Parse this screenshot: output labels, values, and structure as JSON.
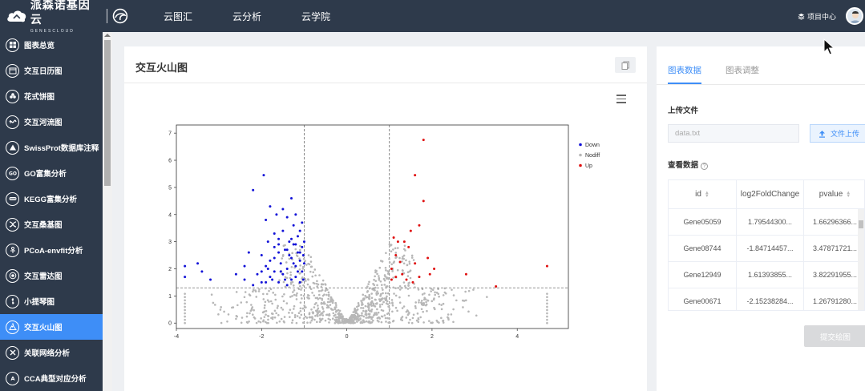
{
  "header": {
    "brand": "派森诺基因云",
    "brand_sub": "GENESCLOUD",
    "nav": [
      "云图汇",
      "云分析",
      "云学院"
    ],
    "project_center": "项目中心"
  },
  "sidebar": {
    "items": [
      {
        "label": "图表总览",
        "icon": "grid-icon"
      },
      {
        "label": "交互日历图",
        "icon": "calendar-icon"
      },
      {
        "label": "花式饼图",
        "icon": "flower-icon"
      },
      {
        "label": "交互河流图",
        "icon": "river-icon"
      },
      {
        "label": "SwissProt数据库注释",
        "icon": "triangle-icon"
      },
      {
        "label": "GO富集分析",
        "icon": "go-icon"
      },
      {
        "label": "KEGG富集分析",
        "icon": "kegg-icon"
      },
      {
        "label": "交互桑基图",
        "icon": "sankey-icon"
      },
      {
        "label": "PCoA-envfit分析",
        "icon": "pcoa-icon"
      },
      {
        "label": "交互雷达图",
        "icon": "radar-icon"
      },
      {
        "label": "小提琴图",
        "icon": "violin-icon"
      },
      {
        "label": "交互火山图",
        "icon": "volcano-icon",
        "active": true
      },
      {
        "label": "关联网络分析",
        "icon": "network-icon"
      },
      {
        "label": "CCA典型对应分析",
        "icon": "cca-icon"
      }
    ]
  },
  "main": {
    "title": "交互火山图"
  },
  "right": {
    "tabs": [
      "图表数据",
      "图表调整"
    ],
    "upload_label": "上传文件",
    "file_value": "data.txt",
    "upload_button": "文件上传",
    "view_data_label": "查看数据",
    "table": {
      "headers": [
        "id",
        "log2FoldChange",
        "pvalue"
      ],
      "rows": [
        [
          "Gene05059",
          "1.79544300...",
          "1.66296366..."
        ],
        [
          "Gene08744",
          "-1.84714457...",
          "3.47871721..."
        ],
        [
          "Gene12949",
          "1.61393855...",
          "3.82291955..."
        ],
        [
          "Gene00671",
          "-2.15238284...",
          "1.26791280..."
        ]
      ]
    },
    "submit_button": "提交绘图"
  },
  "chart_data": {
    "type": "scatter",
    "title": "",
    "xlabel": "",
    "ylabel": "",
    "xlim": [
      -4,
      5.2
    ],
    "ylim": [
      -0.2,
      7.3
    ],
    "xticks": [
      -4,
      -2,
      0,
      2,
      4
    ],
    "yticks": [
      0,
      1,
      2,
      3,
      4,
      5,
      6,
      7
    ],
    "vlines": [
      -1,
      1
    ],
    "hline": 1.3,
    "legend": {
      "position": "top-right"
    },
    "series": [
      {
        "name": "Down",
        "color": "#1313d8",
        "points": [
          [
            -3.8,
            2.1
          ],
          [
            -3.8,
            1.7
          ],
          [
            -3.5,
            2.2
          ],
          [
            -3.4,
            1.9
          ],
          [
            -3.2,
            1.6
          ],
          [
            -2.6,
            1.8
          ],
          [
            -2.4,
            1.6
          ],
          [
            -2.4,
            2.1
          ],
          [
            -2.3,
            2.6
          ],
          [
            -2.2,
            4.9
          ],
          [
            -2.2,
            1.4
          ],
          [
            -2.1,
            1.8
          ],
          [
            -2.0,
            2.5
          ],
          [
            -2.0,
            1.5
          ],
          [
            -1.95,
            5.45
          ],
          [
            -1.9,
            2.1
          ],
          [
            -1.9,
            3.8
          ],
          [
            -1.85,
            3.0
          ],
          [
            -1.8,
            4.3
          ],
          [
            -1.8,
            2.3
          ],
          [
            -1.75,
            1.6
          ],
          [
            -1.7,
            3.3
          ],
          [
            -1.7,
            2.8
          ],
          [
            -1.7,
            1.9
          ],
          [
            -1.65,
            4.0
          ],
          [
            -1.6,
            2.6
          ],
          [
            -1.6,
            3.1
          ],
          [
            -1.6,
            1.5
          ],
          [
            -1.55,
            2.2
          ],
          [
            -1.5,
            4.2
          ],
          [
            -1.5,
            3.4
          ],
          [
            -1.5,
            1.8
          ],
          [
            -1.45,
            2.7
          ],
          [
            -1.4,
            3.9
          ],
          [
            -1.4,
            2.0
          ],
          [
            -1.4,
            1.4
          ],
          [
            -1.35,
            3.0
          ],
          [
            -1.3,
            4.6
          ],
          [
            -1.3,
            2.4
          ],
          [
            -1.3,
            1.6
          ],
          [
            -1.25,
            3.6
          ],
          [
            -1.25,
            2.9
          ],
          [
            -1.2,
            2.1
          ],
          [
            -1.2,
            1.7
          ],
          [
            -1.2,
            4.0
          ],
          [
            -1.15,
            3.2
          ],
          [
            -1.15,
            2.6
          ],
          [
            -1.1,
            1.5
          ],
          [
            -1.1,
            2.3
          ],
          [
            -1.1,
            3.4
          ],
          [
            -1.05,
            2.8
          ],
          [
            -1.05,
            1.9
          ],
          [
            -1.05,
            3.7
          ],
          [
            -1.02,
            2.5
          ],
          [
            -1.02,
            1.6
          ],
          [
            -1.0,
            3.0
          ],
          [
            -1.0,
            2.2
          ],
          [
            -1.6,
            2.9
          ],
          [
            -1.8,
            1.7
          ],
          [
            -1.3,
            3.1
          ],
          [
            -1.45,
            1.6
          ],
          [
            -1.15,
            1.9
          ],
          [
            -1.25,
            2.2
          ],
          [
            -1.35,
            2.5
          ],
          [
            -1.55,
            1.9
          ],
          [
            -1.7,
            2.4
          ],
          [
            -1.85,
            2.0
          ],
          [
            -2.0,
            1.9
          ],
          [
            -1.9,
            1.5
          ],
          [
            -1.4,
            2.7
          ],
          [
            -1.2,
            2.9
          ],
          [
            -1.1,
            2.6
          ]
        ]
      },
      {
        "name": "Nodiff",
        "color": "#b7b7b7",
        "points": []
      },
      {
        "name": "Up",
        "color": "#e01010",
        "points": [
          [
            1.8,
            6.75
          ],
          [
            1.6,
            5.45
          ],
          [
            1.8,
            4.5
          ],
          [
            1.7,
            3.6
          ],
          [
            1.5,
            3.4
          ],
          [
            1.35,
            3.0
          ],
          [
            1.1,
            3.15
          ],
          [
            1.2,
            3.0
          ],
          [
            1.45,
            2.8
          ],
          [
            1.15,
            2.5
          ],
          [
            1.6,
            2.2
          ],
          [
            1.9,
            2.4
          ],
          [
            2.05,
            2.0
          ],
          [
            1.3,
            1.8
          ],
          [
            1.05,
            1.6
          ],
          [
            1.05,
            2.0
          ],
          [
            1.15,
            1.7
          ],
          [
            1.4,
            1.6
          ],
          [
            1.7,
            1.7
          ],
          [
            1.95,
            1.8
          ],
          [
            2.8,
            1.8
          ],
          [
            3.5,
            1.35
          ],
          [
            4.7,
            2.1
          ],
          [
            1.25,
            2.25
          ],
          [
            1.55,
            1.5
          ]
        ]
      }
    ]
  }
}
